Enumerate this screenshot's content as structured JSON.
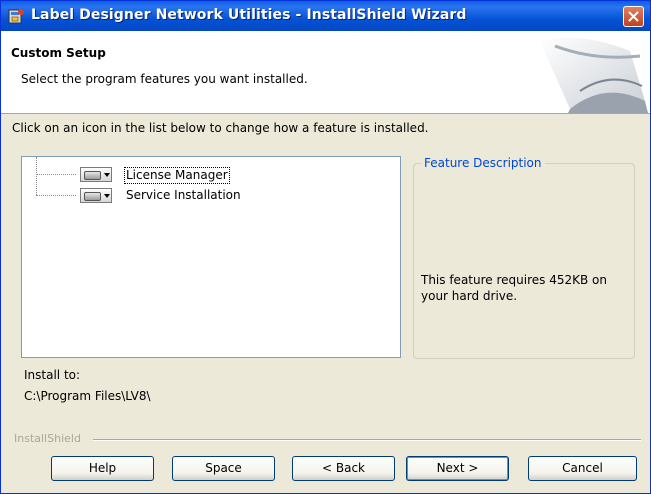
{
  "window": {
    "title": "Label Designer Network Utilities - InstallShield Wizard",
    "app_icon": "installer-icon",
    "close_icon": "close-icon",
    "titlebar_color": "#0553d6"
  },
  "header": {
    "title": "Custom Setup",
    "subtitle": "Select the program features you want installed."
  },
  "instruction": "Click on an icon in the list below to change how a feature is installed.",
  "features": [
    {
      "label": "License Manager",
      "icon": "drive-icon"
    },
    {
      "label": "Service Installation",
      "icon": "drive-icon"
    }
  ],
  "description": {
    "legend": "Feature Description",
    "text": "This feature requires 452KB on your hard drive."
  },
  "install": {
    "label": "Install to:",
    "path": "C:\\Program Files\\LV8\\"
  },
  "brand": "InstallShield",
  "buttons": {
    "help": "Help",
    "space": "Space",
    "back": "< Back",
    "next": "Next >",
    "cancel": "Cancel"
  }
}
